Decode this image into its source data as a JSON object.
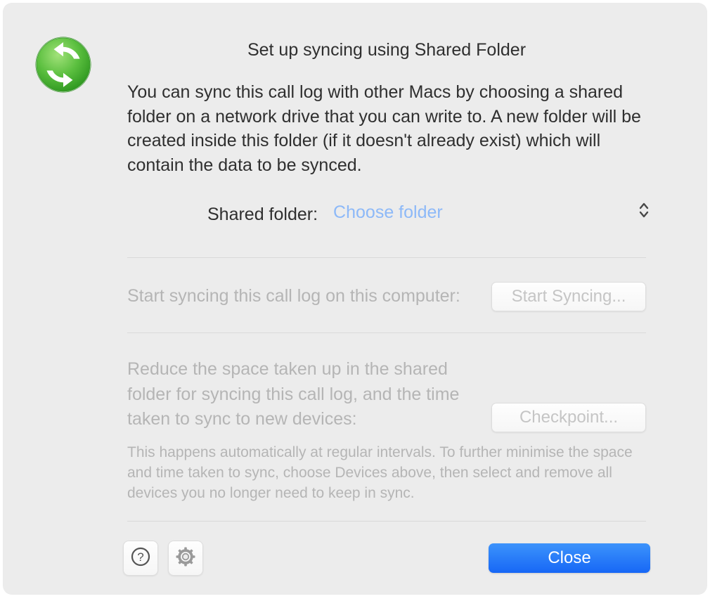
{
  "dialog": {
    "title": "Set up syncing using Shared Folder",
    "description": "You can sync this call log with other Macs by choosing a shared folder on a network drive that you can write to.  A new folder will be created inside this folder (if it doesn't already exist) which will contain the data to be synced."
  },
  "folder": {
    "label": "Shared folder:",
    "placeholder": "Choose folder"
  },
  "startSync": {
    "text": "Start syncing this call log on this computer:",
    "button": "Start Syncing..."
  },
  "checkpoint": {
    "text": "Reduce the space taken up in the shared folder for syncing this call log, and the time taken to sync to new devices:",
    "button": "Checkpoint...",
    "note": "This happens automatically at regular intervals. To further minimise the space and time taken to sync, choose Devices above, then select and remove all devices you no longer need to keep in sync."
  },
  "footer": {
    "close": "Close"
  }
}
